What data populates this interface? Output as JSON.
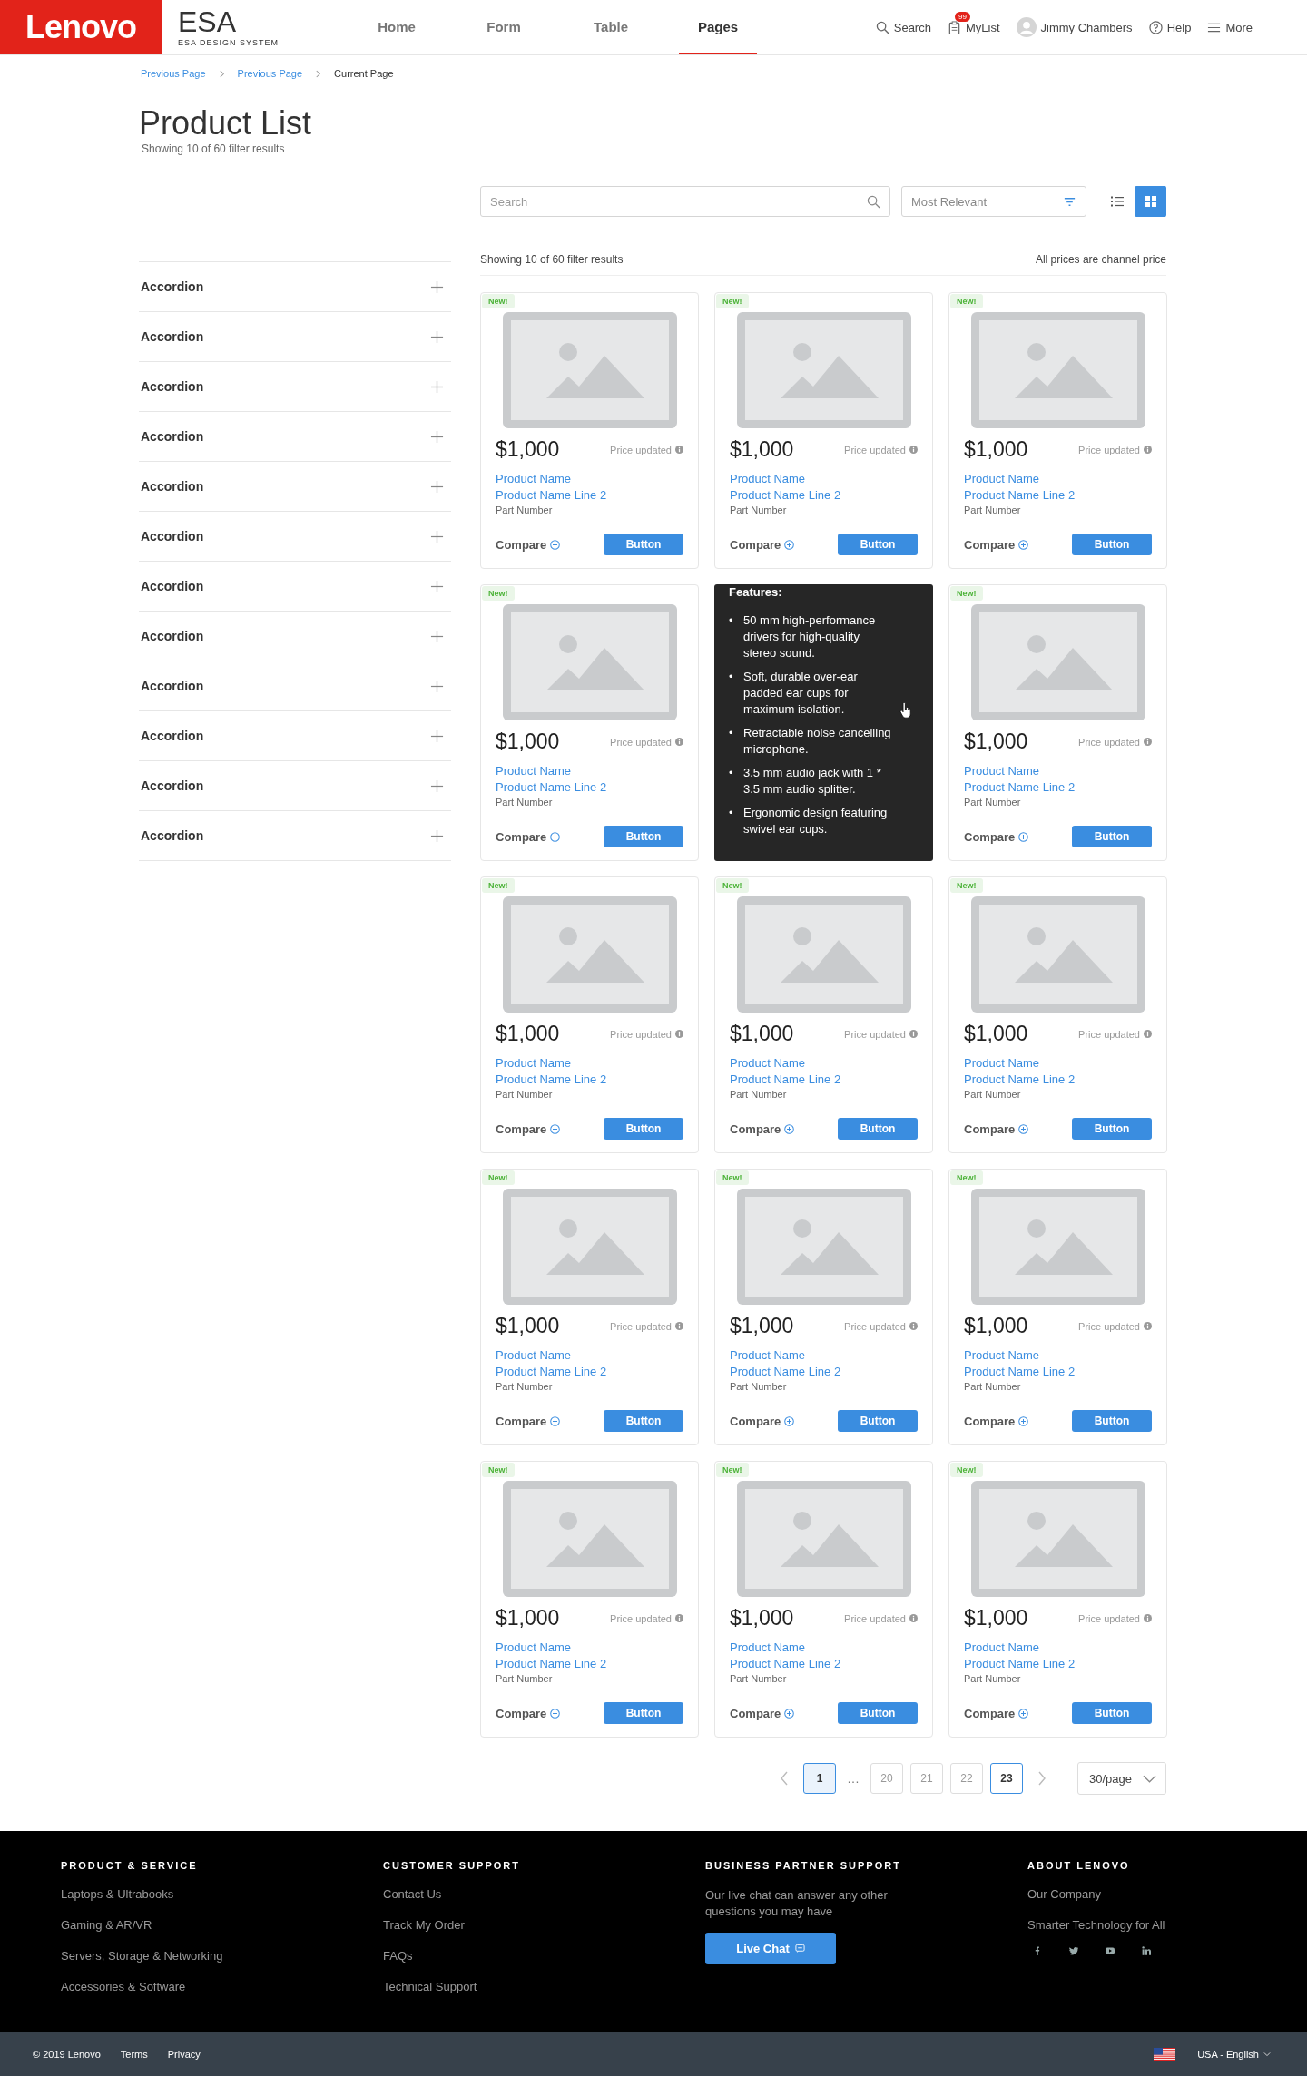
{
  "header": {
    "logo": "Lenovo",
    "brand": "ESA",
    "brand_sub": "ESA DESIGN SYSTEM",
    "nav": [
      {
        "label": "Home",
        "selected": false
      },
      {
        "label": "Form",
        "selected": false
      },
      {
        "label": "Table",
        "selected": false
      },
      {
        "label": "Pages",
        "selected": true
      }
    ],
    "tools": [
      {
        "kind": "search",
        "label": "Search"
      },
      {
        "kind": "list",
        "label": "MyList",
        "badge": "99"
      },
      {
        "kind": "user",
        "label": "Jimmy Chambers"
      },
      {
        "kind": "help",
        "label": "Help"
      },
      {
        "kind": "menu",
        "label": "More"
      }
    ]
  },
  "breadcrumbs": [
    {
      "label": "Previous Page",
      "current": false
    },
    {
      "label": "Previous Page",
      "current": false
    },
    {
      "label": "Current Page",
      "current": true
    }
  ],
  "page_title": "Product List",
  "subtitle": "Showing 10 of 60 filter results",
  "accordions": [
    {
      "label": "Accordion",
      "expanded": false
    },
    {
      "label": "Accordion",
      "expanded": false
    },
    {
      "label": "Accordion",
      "expanded": false
    },
    {
      "label": "Accordion",
      "expanded": false
    },
    {
      "label": "Accordion",
      "expanded": false
    },
    {
      "label": "Accordion",
      "expanded": false
    },
    {
      "label": "Accordion",
      "expanded": false
    },
    {
      "label": "Accordion",
      "expanded": false
    },
    {
      "label": "Accordion",
      "expanded": false
    },
    {
      "label": "Accordion",
      "expanded": false
    },
    {
      "label": "Accordion",
      "expanded": false
    },
    {
      "label": "Accordion",
      "expanded": false
    }
  ],
  "toolbar": {
    "search_placeholder": "Search",
    "sort": "Most Relevant",
    "views": [
      {
        "kind": "list",
        "selected": false
      },
      {
        "kind": "grid",
        "selected": true
      }
    ]
  },
  "results": {
    "count": "Showing 10 of 60 filter results",
    "note": "All prices are channel price"
  },
  "cards": [
    {
      "kind": "product",
      "badge": "New!",
      "price": "$1,000",
      "price_note": "Price updated",
      "name": "Product Name",
      "name_line2": "Product Name Line 2",
      "part": "Part Number",
      "compare": "Compare",
      "button": "Button"
    },
    {
      "kind": "product",
      "badge": "New!",
      "price": "$1,000",
      "price_note": "Price updated",
      "name": "Product Name",
      "name_line2": "Product Name Line 2",
      "part": "Part Number",
      "compare": "Compare",
      "button": "Button"
    },
    {
      "kind": "product",
      "badge": "New!",
      "price": "$1,000",
      "price_note": "Price updated",
      "name": "Product Name",
      "name_line2": "Product Name Line 2",
      "part": "Part Number",
      "compare": "Compare",
      "button": "Button"
    },
    {
      "kind": "product",
      "badge": "New!",
      "price": "$1,000",
      "price_note": "Price updated",
      "name": "Product Name",
      "name_line2": "Product Name Line 2",
      "part": "Part Number",
      "compare": "Compare",
      "button": "Button"
    },
    {
      "kind": "tooltip",
      "title": "Features:",
      "bullet": "•",
      "features": [
        "50 mm high-performance drivers for high-quality stereo sound.",
        "Soft, durable over-ear padded ear cups for maximum isolation.",
        "Retractable noise cancelling microphone.",
        "3.5 mm audio jack with 1 * 3.5 mm audio splitter.",
        "Ergonomic design featuring swivel ear cups."
      ]
    },
    {
      "kind": "product",
      "badge": "New!",
      "price": "$1,000",
      "price_note": "Price updated",
      "name": "Product Name",
      "name_line2": "Product Name Line 2",
      "part": "Part Number",
      "compare": "Compare",
      "button": "Button"
    },
    {
      "kind": "product",
      "badge": "New!",
      "price": "$1,000",
      "price_note": "Price updated",
      "name": "Product Name",
      "name_line2": "Product Name Line 2",
      "part": "Part Number",
      "compare": "Compare",
      "button": "Button"
    },
    {
      "kind": "product",
      "badge": "New!",
      "price": "$1,000",
      "price_note": "Price updated",
      "name": "Product Name",
      "name_line2": "Product Name Line 2",
      "part": "Part Number",
      "compare": "Compare",
      "button": "Button"
    },
    {
      "kind": "product",
      "badge": "New!",
      "price": "$1,000",
      "price_note": "Price updated",
      "name": "Product Name",
      "name_line2": "Product Name Line 2",
      "part": "Part Number",
      "compare": "Compare",
      "button": "Button"
    },
    {
      "kind": "product",
      "badge": "New!",
      "price": "$1,000",
      "price_note": "Price updated",
      "name": "Product Name",
      "name_line2": "Product Name Line 2",
      "part": "Part Number",
      "compare": "Compare",
      "button": "Button"
    },
    {
      "kind": "product",
      "badge": "New!",
      "price": "$1,000",
      "price_note": "Price updated",
      "name": "Product Name",
      "name_line2": "Product Name Line 2",
      "part": "Part Number",
      "compare": "Compare",
      "button": "Button"
    },
    {
      "kind": "product",
      "badge": "New!",
      "price": "$1,000",
      "price_note": "Price updated",
      "name": "Product Name",
      "name_line2": "Product Name Line 2",
      "part": "Part Number",
      "compare": "Compare",
      "button": "Button"
    },
    {
      "kind": "product",
      "badge": "New!",
      "price": "$1,000",
      "price_note": "Price updated",
      "name": "Product Name",
      "name_line2": "Product Name Line 2",
      "part": "Part Number",
      "compare": "Compare",
      "button": "Button"
    },
    {
      "kind": "product",
      "badge": "New!",
      "price": "$1,000",
      "price_note": "Price updated",
      "name": "Product Name",
      "name_line2": "Product Name Line 2",
      "part": "Part Number",
      "compare": "Compare",
      "button": "Button"
    },
    {
      "kind": "product",
      "badge": "New!",
      "price": "$1,000",
      "price_note": "Price updated",
      "name": "Product Name",
      "name_line2": "Product Name Line 2",
      "part": "Part Number",
      "compare": "Compare",
      "button": "Button"
    }
  ],
  "pagination": {
    "items": [
      {
        "kind": "page",
        "label": "1",
        "selected": true,
        "focused": false
      },
      {
        "kind": "ellipsis",
        "label": "…"
      },
      {
        "kind": "page",
        "label": "20",
        "selected": false,
        "focused": false
      },
      {
        "kind": "page",
        "label": "21",
        "selected": false,
        "focused": false
      },
      {
        "kind": "page",
        "label": "22",
        "selected": false,
        "focused": false
      },
      {
        "kind": "page",
        "label": "23",
        "selected": false,
        "focused": true
      }
    ],
    "page_size": "30/page"
  },
  "footer": {
    "columns": [
      {
        "title": "PRODUCT & SERVICE",
        "links": [
          "Laptops & Ultrabooks",
          "Gaming & AR/VR",
          "Servers, Storage & Networking",
          "Accessories & Software"
        ]
      },
      {
        "title": "CUSTOMER SUPPORT",
        "links": [
          "Contact Us",
          "Track My Order",
          "FAQs",
          "Technical Support"
        ]
      },
      {
        "title": "BUSINESS PARTNER SUPPORT",
        "text": "Our live chat can answer any other questions you may have",
        "button": "Live Chat"
      },
      {
        "title": "ABOUT LENOVO",
        "links": [
          "Our Company",
          "Smarter Technology for All"
        ],
        "social": true
      }
    ],
    "copyright": "© 2019 Lenovo",
    "legal": [
      "Terms",
      "Privacy"
    ],
    "locale": "USA - English"
  }
}
